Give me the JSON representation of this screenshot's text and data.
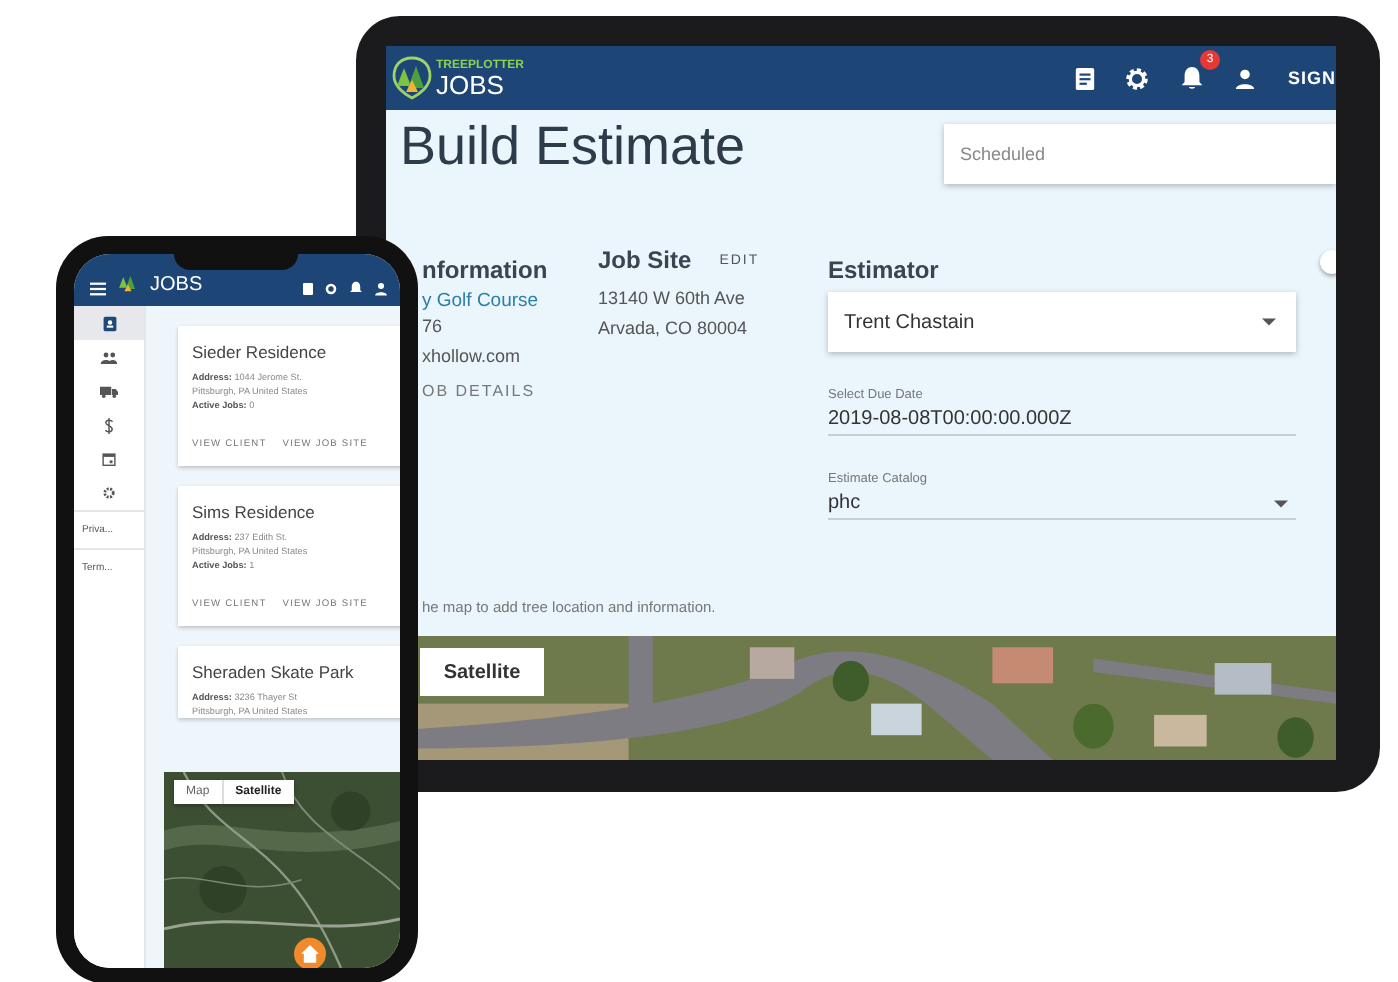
{
  "tablet": {
    "header": {
      "logo_top": "TREEPLOTTER",
      "logo_bottom": "JOBS",
      "notification_count": "3",
      "sign_in": "SIGN"
    },
    "title": "Build Estimate",
    "status_field": {
      "placeholder": "Scheduled"
    },
    "client": {
      "heading": "nformation",
      "name": "y Golf Course",
      "phone": "76",
      "email": "xhollow.com",
      "link": "OB DETAILS"
    },
    "job_site": {
      "heading": "Job Site",
      "edit": "EDIT",
      "lines": [
        "13140 W 60th Ave",
        "Arvada, CO 80004"
      ]
    },
    "estimator": {
      "heading": "Estimator",
      "value": "Trent Chastain",
      "due_date": {
        "label": "Select Due Date",
        "value": "2019-08-08T00:00:00.000Z"
      },
      "catalog": {
        "label": "Estimate Catalog",
        "value": "phc"
      }
    },
    "hint": "he map to add tree location and information.",
    "map": {
      "kind": "picture",
      "type_button": "Satellite"
    }
  },
  "phone": {
    "header": {
      "logo": "JOBS"
    },
    "sidebar": {
      "items": [
        {
          "kind": "contacts",
          "selected": true
        },
        {
          "kind": "people",
          "selected": false
        },
        {
          "kind": "truck",
          "selected": false
        },
        {
          "kind": "money",
          "selected": false
        },
        {
          "kind": "calendar",
          "selected": false
        },
        {
          "kind": "settings",
          "selected": false
        }
      ],
      "links": [
        "Priva...",
        "Term..."
      ]
    },
    "cards": [
      {
        "title": "Sieder Residence",
        "lines": [
          "**Address:** 1044 Jerome St.",
          "Pittsburgh, PA United States",
          "**Active Jobs:** 0"
        ],
        "actions": [
          "VIEW CLIENT",
          "VIEW JOB SITE"
        ]
      },
      {
        "title": "Sims Residence",
        "lines": [
          "**Address:** 237 Edith St.",
          "Pittsburgh, PA United States",
          "**Active Jobs:** 1"
        ],
        "actions": [
          "VIEW CLIENT",
          "VIEW JOB SITE"
        ]
      },
      {
        "title": "Sheraden Skate Park",
        "lines": [
          "**Address:** 3236 Thayer St",
          "Pittsburgh, PA United States"
        ]
      }
    ],
    "map": {
      "kind": "picture",
      "types": [
        {
          "label": "Map",
          "selected": false
        },
        {
          "label": "Satellite",
          "selected": true
        }
      ]
    }
  }
}
